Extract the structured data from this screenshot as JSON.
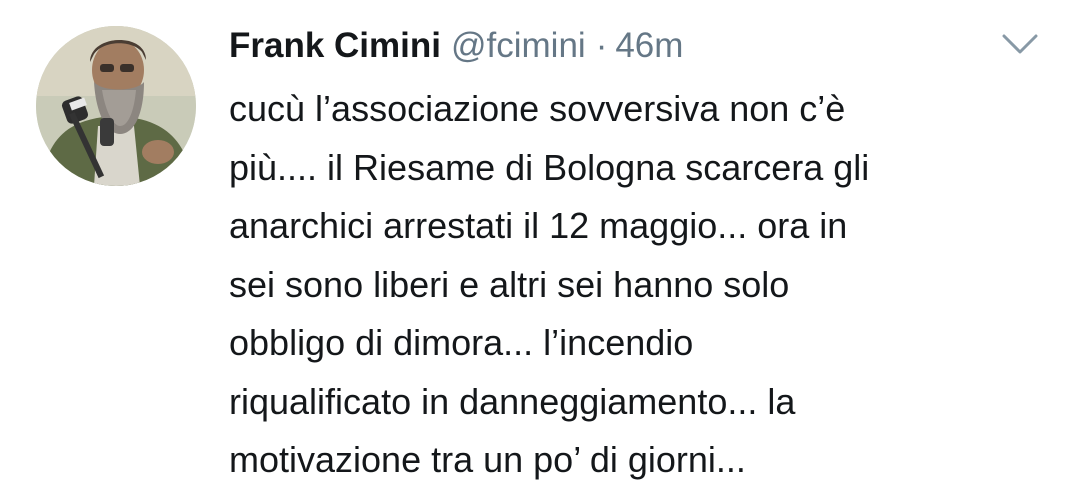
{
  "tweet": {
    "author": {
      "name": "Frank Cimini",
      "handle": "@fcimini",
      "avatar_icon": "person-with-microphone-avatar"
    },
    "separator": "·",
    "time": "46m",
    "menu_icon": "chevron-down-icon",
    "text_lines": [
      "cucù l’associazione sovversiva non c’è",
      "più.... il Riesame di Bologna scarcera gli",
      "anarchici arrestati il 12 maggio... ora in",
      "sei sono liberi e altri sei hanno solo",
      "obbligo di dimora... l’incendio",
      "riqualificato in danneggiamento... la",
      "motivazione tra un po’ di giorni..."
    ]
  },
  "colors": {
    "text_primary": "#14171a",
    "text_secondary": "#657786",
    "chevron": "#8899a6",
    "background": "#ffffff"
  }
}
